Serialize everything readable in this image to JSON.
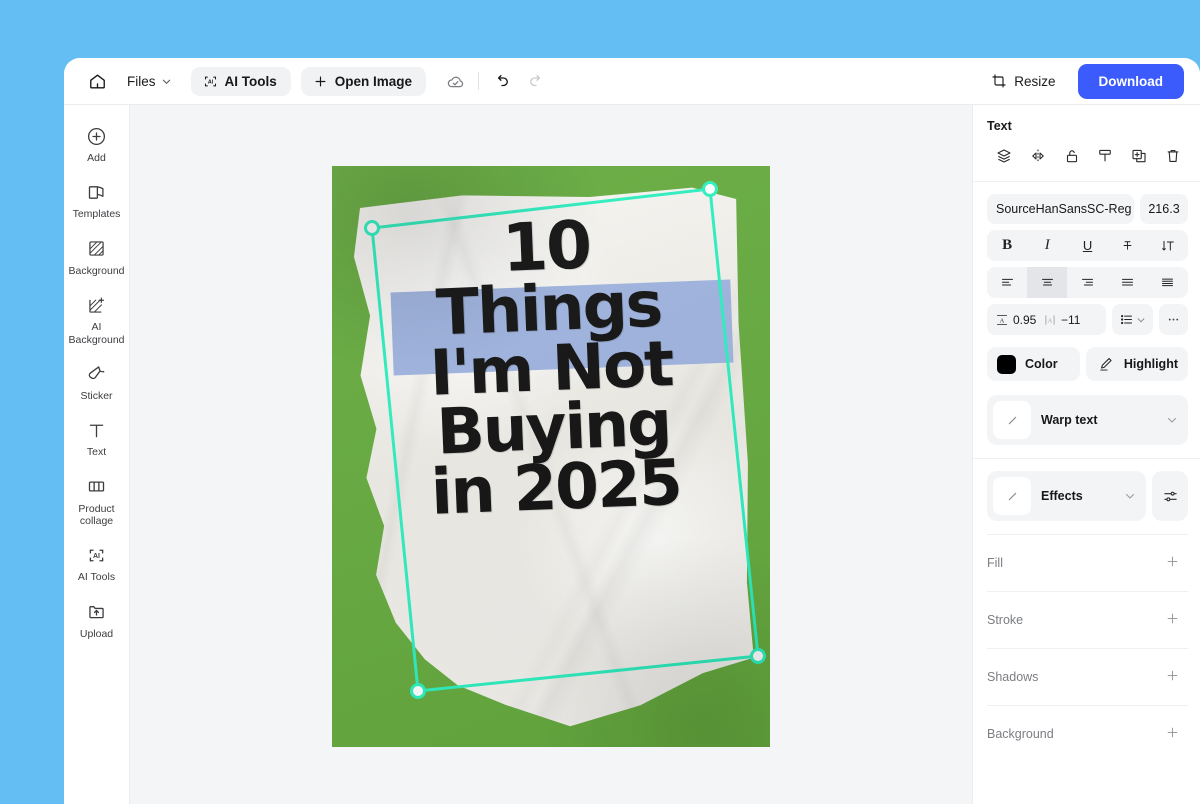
{
  "theme": {
    "page_backdrop": "#64bdf3",
    "accent_blue": "#3b5bfd",
    "canvas_bg": "#f4f5f7",
    "selection_color": "#2df0c0",
    "artboard_green": "#66ab3f",
    "highlight_periwinkle": "#9fb4e0",
    "text_black": "#121212"
  },
  "toolbar": {
    "home_icon": "home-icon",
    "files_label": "Files",
    "files_caret": "chevron-down-icon",
    "ai_tools_label": "AI Tools",
    "ai_tools_icon": "ai-brackets-icon",
    "open_image_label": "Open Image",
    "open_image_icon": "plus-icon",
    "cloud_saved_icon": "cloud-check-icon",
    "undo_icon": "undo-icon",
    "redo_icon": "redo-icon",
    "resize_label": "Resize",
    "resize_icon": "crop-resize-icon",
    "download_label": "Download"
  },
  "sidebar": {
    "items": [
      {
        "label": "Add",
        "icon": "plus-circle-icon"
      },
      {
        "label": "Templates",
        "icon": "templates-icon"
      },
      {
        "label": "Background",
        "icon": "hatch-square-icon"
      },
      {
        "label": "AI\nBackground",
        "icon": "hatch-sparkle-icon"
      },
      {
        "label": "Sticker",
        "icon": "sticker-icon"
      },
      {
        "label": "Text",
        "icon": "text-t-icon"
      },
      {
        "label": "Product\ncollage",
        "icon": "collage-icon"
      },
      {
        "label": "AI Tools",
        "icon": "ai-brackets-icon"
      },
      {
        "label": "Upload",
        "icon": "upload-folder-icon"
      }
    ]
  },
  "canvas": {
    "poster": {
      "lines": [
        "10",
        "Things",
        "I'm Not",
        "Buying",
        "in 2025"
      ],
      "background_color": "#66ab3f",
      "highlight_line_index": 1
    },
    "selection": {
      "label": "text-selection-box",
      "handles": 4
    }
  },
  "panel": {
    "title": "Text",
    "object_actions": [
      {
        "name": "layers-icon",
        "label": "Layers"
      },
      {
        "name": "flip-icon",
        "label": "Flip"
      },
      {
        "name": "unlock-icon",
        "label": "Unlock"
      },
      {
        "name": "format-painter-icon",
        "label": "Format painter"
      },
      {
        "name": "duplicate-icon",
        "label": "Duplicate"
      },
      {
        "name": "trash-icon",
        "label": "Delete"
      }
    ],
    "font_family": "SourceHanSansSC-Reg",
    "font_size": "216.3",
    "style_buttons": [
      {
        "name": "bold-button",
        "glyph": "B",
        "active": false
      },
      {
        "name": "italic-button",
        "glyph": "I",
        "active": false
      },
      {
        "name": "underline-button",
        "glyph": "U",
        "active": false
      },
      {
        "name": "strikethrough-button",
        "glyph": "T",
        "active": false
      },
      {
        "name": "text-direction-button",
        "glyph": "IT",
        "active": false
      }
    ],
    "align_buttons": [
      {
        "name": "align-left-button",
        "active": false
      },
      {
        "name": "align-center-button",
        "active": true
      },
      {
        "name": "align-right-button",
        "active": false
      },
      {
        "name": "align-justify-button",
        "active": false
      },
      {
        "name": "align-distribute-button",
        "active": false
      }
    ],
    "line_height_icon": "line-height-icon",
    "line_height_value": "0.95",
    "letter_spacing_icon": "letter-spacing-icon",
    "letter_spacing_value": "−11",
    "list_icon": "bullet-list-icon",
    "list_caret": "chevron-down-icon",
    "more_icon": "more-horizontal-icon",
    "color_label": "Color",
    "color_value": "#000000",
    "highlight_label": "Highlight",
    "highlight_icon": "highlighter-pen-icon",
    "warp_text_label": "Warp text",
    "warp_text_caret": "chevron-down-icon",
    "effects_label": "Effects",
    "effects_caret": "chevron-down-icon",
    "effects_settings_icon": "sliders-icon",
    "accordion": [
      {
        "label": "Fill",
        "action": "plus-icon"
      },
      {
        "label": "Stroke",
        "action": "plus-icon"
      },
      {
        "label": "Shadows",
        "action": "plus-icon"
      },
      {
        "label": "Background",
        "action": "plus-icon"
      }
    ]
  }
}
